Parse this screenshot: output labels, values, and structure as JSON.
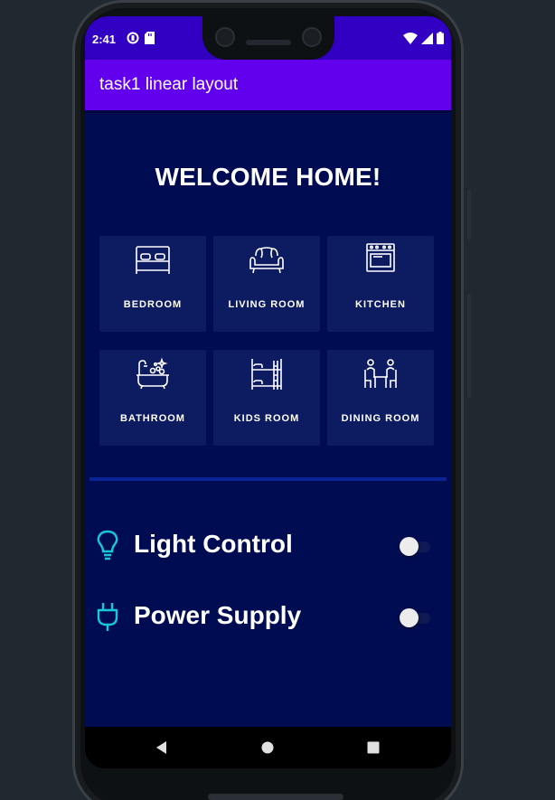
{
  "status_bar": {
    "time": "2:41",
    "left_icons": [
      "data-saver-icon",
      "sd-card-icon"
    ],
    "right_icons": [
      "wifi-icon",
      "signal-icon",
      "battery-icon"
    ]
  },
  "app_bar": {
    "title": "task1 linear layout"
  },
  "main": {
    "heading": "WELCOME HOME!",
    "rooms": [
      {
        "label": "BEDROOM",
        "icon": "bed-icon"
      },
      {
        "label": "LIVING ROOM",
        "icon": "sofa-icon"
      },
      {
        "label": "KITCHEN",
        "icon": "oven-icon"
      },
      {
        "label": "BATHROOM",
        "icon": "bathtub-icon"
      },
      {
        "label": "KIDS ROOM",
        "icon": "bunk-bed-icon"
      },
      {
        "label": "DINING ROOM",
        "icon": "dining-table-icon"
      }
    ],
    "controls": [
      {
        "label": "Light Control",
        "icon": "lightbulb-icon",
        "switch_on": false
      },
      {
        "label": "Power Supply",
        "icon": "power-plug-icon",
        "switch_on": false
      }
    ]
  },
  "nav_bar": {
    "buttons": [
      "back-icon",
      "home-icon",
      "recents-icon"
    ]
  },
  "colors": {
    "status_bar": "#3200c2",
    "app_bar": "#6200ee",
    "background": "#000c52",
    "card": "#0d1b61",
    "divider": "#0b2495",
    "accent_icon": "#18c8d8"
  }
}
